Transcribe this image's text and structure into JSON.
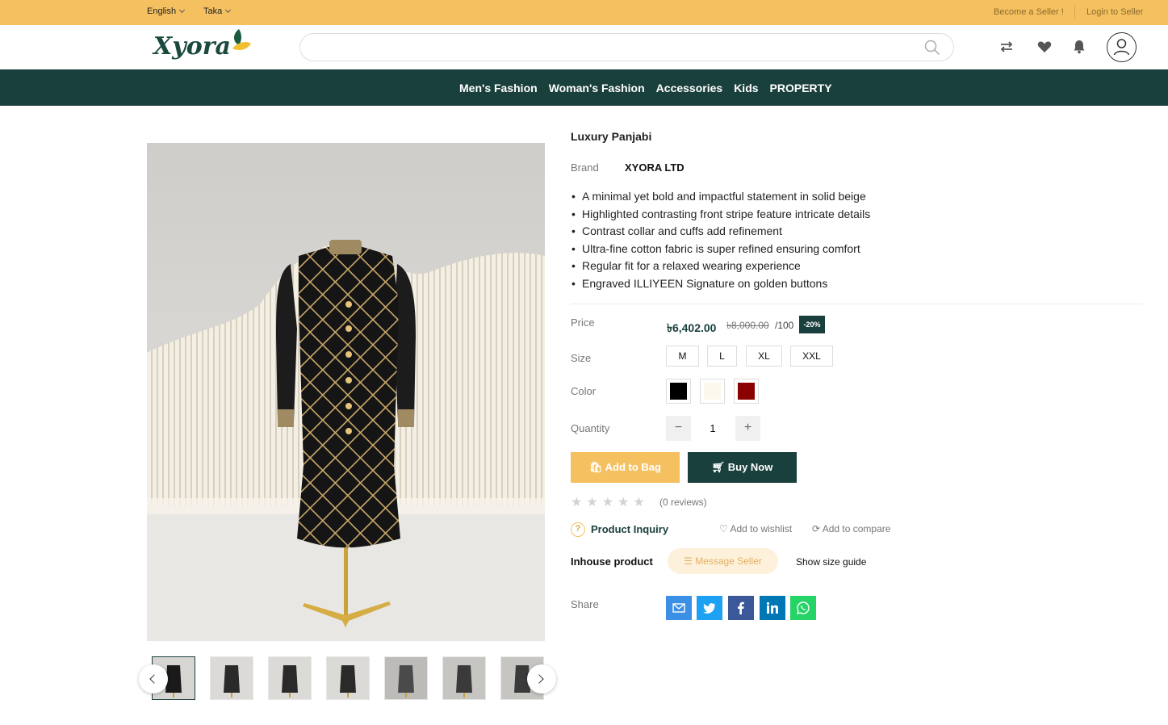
{
  "topbar": {
    "language": "English",
    "currency": "Taka",
    "become_seller": "Become a Seller !",
    "login_seller": "Login to Seller"
  },
  "header": {
    "logo_text": "Xyora",
    "search_placeholder": "",
    "icons": [
      "compare-icon",
      "heart-icon",
      "bell-icon",
      "user-icon"
    ]
  },
  "nav": {
    "items": [
      "Men's Fashion",
      "Woman's Fashion",
      "Accessories",
      "Kids",
      "PROPERTY"
    ]
  },
  "product": {
    "title": "Luxury Panjabi",
    "brand_label": "Brand",
    "brand": "XYORA LTD",
    "features": [
      "A minimal yet bold and impactful statement in solid beige",
      "Highlighted contrasting front stripe feature intricate details",
      "Contrast collar and cuffs add refinement",
      "Ultra-fine cotton fabric is super refined ensuring comfort",
      "Regular fit for a relaxed wearing experience",
      "Engraved ILLIYEEN Signature on golden buttons"
    ],
    "price_label": "Price",
    "price": "৳6,402.00",
    "old_price": "৳8,000.00",
    "unit": "/100",
    "discount": "-20%",
    "size_label": "Size",
    "sizes": [
      "M",
      "L",
      "XL",
      "XXL"
    ],
    "color_label": "Color",
    "colors": [
      "#000000",
      "#fdf8ee",
      "#8b0000"
    ],
    "quantity_label": "Quantity",
    "quantity": "1",
    "add_to_bag": "Add to Bag",
    "buy_now": "Buy Now",
    "rating": 0,
    "reviews": "(0 reviews)",
    "product_inquiry": "Product Inquiry",
    "add_to_wishlist": "Add to wishlist",
    "add_to_compare": "Add to compare",
    "inhouse": "Inhouse product",
    "message_seller": "Message Seller",
    "size_guide": "Show size guide",
    "share_label": "Share",
    "share_buttons": [
      {
        "name": "email",
        "color": "#3b8fe5"
      },
      {
        "name": "twitter",
        "color": "#1da1f2"
      },
      {
        "name": "facebook",
        "color": "#3b5998"
      },
      {
        "name": "linkedin",
        "color": "#0077b5"
      },
      {
        "name": "whatsapp",
        "color": "#25d366"
      }
    ]
  },
  "gallery": {
    "thumbnail_count": 7,
    "active_index": 0
  },
  "colors": {
    "topbar": "#f5c160",
    "nav": "#1a403d",
    "accent": "#1a403d"
  }
}
